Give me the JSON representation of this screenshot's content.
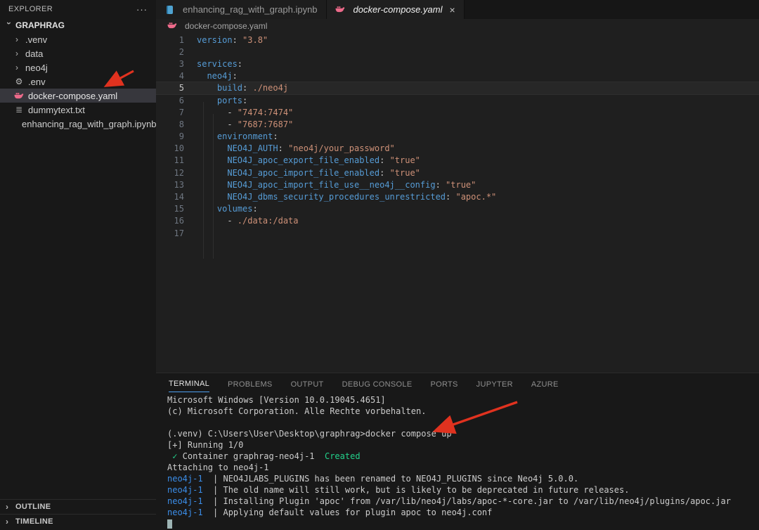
{
  "colors": {
    "yaml_key": "#569cd6",
    "yaml_string": "#ce9178",
    "terminal_blue": "#3b8eea",
    "terminal_green": "#23d18b",
    "accent_blue": "#4d9fef",
    "docker_pink": "#ed6a8a",
    "arrow_red": "#e0321f",
    "selected_row": "#37373d"
  },
  "icons": {
    "more": "···",
    "chevron": "›",
    "close": "×",
    "gear": "⚙",
    "text_file": "≣",
    "check": "✓"
  },
  "explorer": {
    "title": "EXPLORER",
    "root": "GRAPHRAG",
    "items": [
      {
        "label": ".venv",
        "type": "folder"
      },
      {
        "label": "data",
        "type": "folder"
      },
      {
        "label": "neo4j",
        "type": "folder"
      },
      {
        "label": ".env",
        "type": "gear"
      },
      {
        "label": "docker-compose.yaml",
        "type": "docker",
        "selected": true
      },
      {
        "label": "dummytext.txt",
        "type": "text"
      },
      {
        "label": "enhancing_rag_with_graph.ipynb",
        "type": "notebook"
      }
    ],
    "sections": [
      {
        "label": "OUTLINE"
      },
      {
        "label": "TIMELINE"
      }
    ]
  },
  "tabs": [
    {
      "label": "enhancing_rag_with_graph.ipynb",
      "icon": "notebook",
      "active": false,
      "italic": false
    },
    {
      "label": "docker-compose.yaml",
      "icon": "docker",
      "active": true,
      "italic": true,
      "closable": true
    }
  ],
  "breadcrumb": {
    "label": "docker-compose.yaml",
    "icon": "docker"
  },
  "editor": {
    "language": "yaml",
    "active_line": 5,
    "lines": [
      {
        "n": 1,
        "segs": [
          [
            "k",
            "version"
          ],
          [
            "d",
            ": "
          ],
          [
            "s",
            "\"3.8\""
          ]
        ]
      },
      {
        "n": 2,
        "segs": []
      },
      {
        "n": 3,
        "segs": [
          [
            "k",
            "services"
          ],
          [
            "d",
            ":"
          ]
        ]
      },
      {
        "n": 4,
        "segs": [
          [
            "d",
            "  "
          ],
          [
            "k",
            "neo4j"
          ],
          [
            "d",
            ":"
          ]
        ]
      },
      {
        "n": 5,
        "segs": [
          [
            "d",
            "    "
          ],
          [
            "k",
            "build"
          ],
          [
            "d",
            ": "
          ],
          [
            "s",
            "./neo4j"
          ]
        ]
      },
      {
        "n": 6,
        "segs": [
          [
            "d",
            "    "
          ],
          [
            "k",
            "ports"
          ],
          [
            "d",
            ":"
          ]
        ]
      },
      {
        "n": 7,
        "segs": [
          [
            "d",
            "      - "
          ],
          [
            "s",
            "\"7474:7474\""
          ]
        ]
      },
      {
        "n": 8,
        "segs": [
          [
            "d",
            "      - "
          ],
          [
            "s",
            "\"7687:7687\""
          ]
        ]
      },
      {
        "n": 9,
        "segs": [
          [
            "d",
            "    "
          ],
          [
            "k",
            "environment"
          ],
          [
            "d",
            ":"
          ]
        ]
      },
      {
        "n": 10,
        "segs": [
          [
            "d",
            "      "
          ],
          [
            "k",
            "NEO4J_AUTH"
          ],
          [
            "d",
            ": "
          ],
          [
            "s",
            "\"neo4j/your_password\""
          ]
        ]
      },
      {
        "n": 11,
        "segs": [
          [
            "d",
            "      "
          ],
          [
            "k",
            "NEO4J_apoc_export_file_enabled"
          ],
          [
            "d",
            ": "
          ],
          [
            "s",
            "\"true\""
          ]
        ]
      },
      {
        "n": 12,
        "segs": [
          [
            "d",
            "      "
          ],
          [
            "k",
            "NEO4J_apoc_import_file_enabled"
          ],
          [
            "d",
            ": "
          ],
          [
            "s",
            "\"true\""
          ]
        ]
      },
      {
        "n": 13,
        "segs": [
          [
            "d",
            "      "
          ],
          [
            "k",
            "NEO4J_apoc_import_file_use__neo4j__config"
          ],
          [
            "d",
            ": "
          ],
          [
            "s",
            "\"true\""
          ]
        ]
      },
      {
        "n": 14,
        "segs": [
          [
            "d",
            "      "
          ],
          [
            "k",
            "NEO4J_dbms_security_procedures_unrestricted"
          ],
          [
            "d",
            ": "
          ],
          [
            "s",
            "\"apoc.*\""
          ]
        ]
      },
      {
        "n": 15,
        "segs": [
          [
            "d",
            "    "
          ],
          [
            "k",
            "volumes"
          ],
          [
            "d",
            ":"
          ]
        ]
      },
      {
        "n": 16,
        "segs": [
          [
            "d",
            "      - "
          ],
          [
            "s",
            "./data:/data"
          ]
        ]
      },
      {
        "n": 17,
        "segs": []
      }
    ]
  },
  "panel": {
    "tabs": [
      {
        "label": "TERMINAL",
        "active": true
      },
      {
        "label": "PROBLEMS",
        "active": false
      },
      {
        "label": "OUTPUT",
        "active": false
      },
      {
        "label": "DEBUG CONSOLE",
        "active": false
      },
      {
        "label": "PORTS",
        "active": false
      },
      {
        "label": "JUPYTER",
        "active": false
      },
      {
        "label": "AZURE",
        "active": false
      }
    ],
    "terminal_lines": [
      [
        [
          "d",
          "Microsoft Windows [Version 10.0.19045.4651]"
        ]
      ],
      [
        [
          "d",
          "(c) Microsoft Corporation. Alle Rechte vorbehalten."
        ]
      ],
      [],
      [
        [
          "d",
          "(.venv) C:\\Users\\User\\Desktop\\graphrag>docker compose up"
        ]
      ],
      [
        [
          "d",
          "[+] Running 1/0"
        ]
      ],
      [
        [
          "g",
          " ✓"
        ],
        [
          "d",
          " Container graphrag-neo4j-1  "
        ],
        [
          "g",
          "Created"
        ]
      ],
      [
        [
          "d",
          "Attaching to neo4j-1"
        ]
      ],
      [
        [
          "b",
          "neo4j-1 "
        ],
        [
          "d",
          " | NEO4JLABS_PLUGINS has been renamed to NEO4J_PLUGINS since Neo4j 5.0.0."
        ]
      ],
      [
        [
          "b",
          "neo4j-1 "
        ],
        [
          "d",
          " | The old name will still work, but is likely to be deprecated in future releases."
        ]
      ],
      [
        [
          "b",
          "neo4j-1 "
        ],
        [
          "d",
          " | Installing Plugin 'apoc' from /var/lib/neo4j/labs/apoc-*-core.jar to /var/lib/neo4j/plugins/apoc.jar"
        ]
      ],
      [
        [
          "b",
          "neo4j-1 "
        ],
        [
          "d",
          " | Applying default values for plugin apoc to neo4j.conf"
        ]
      ],
      [
        [
          "cursor",
          ""
        ]
      ]
    ]
  }
}
